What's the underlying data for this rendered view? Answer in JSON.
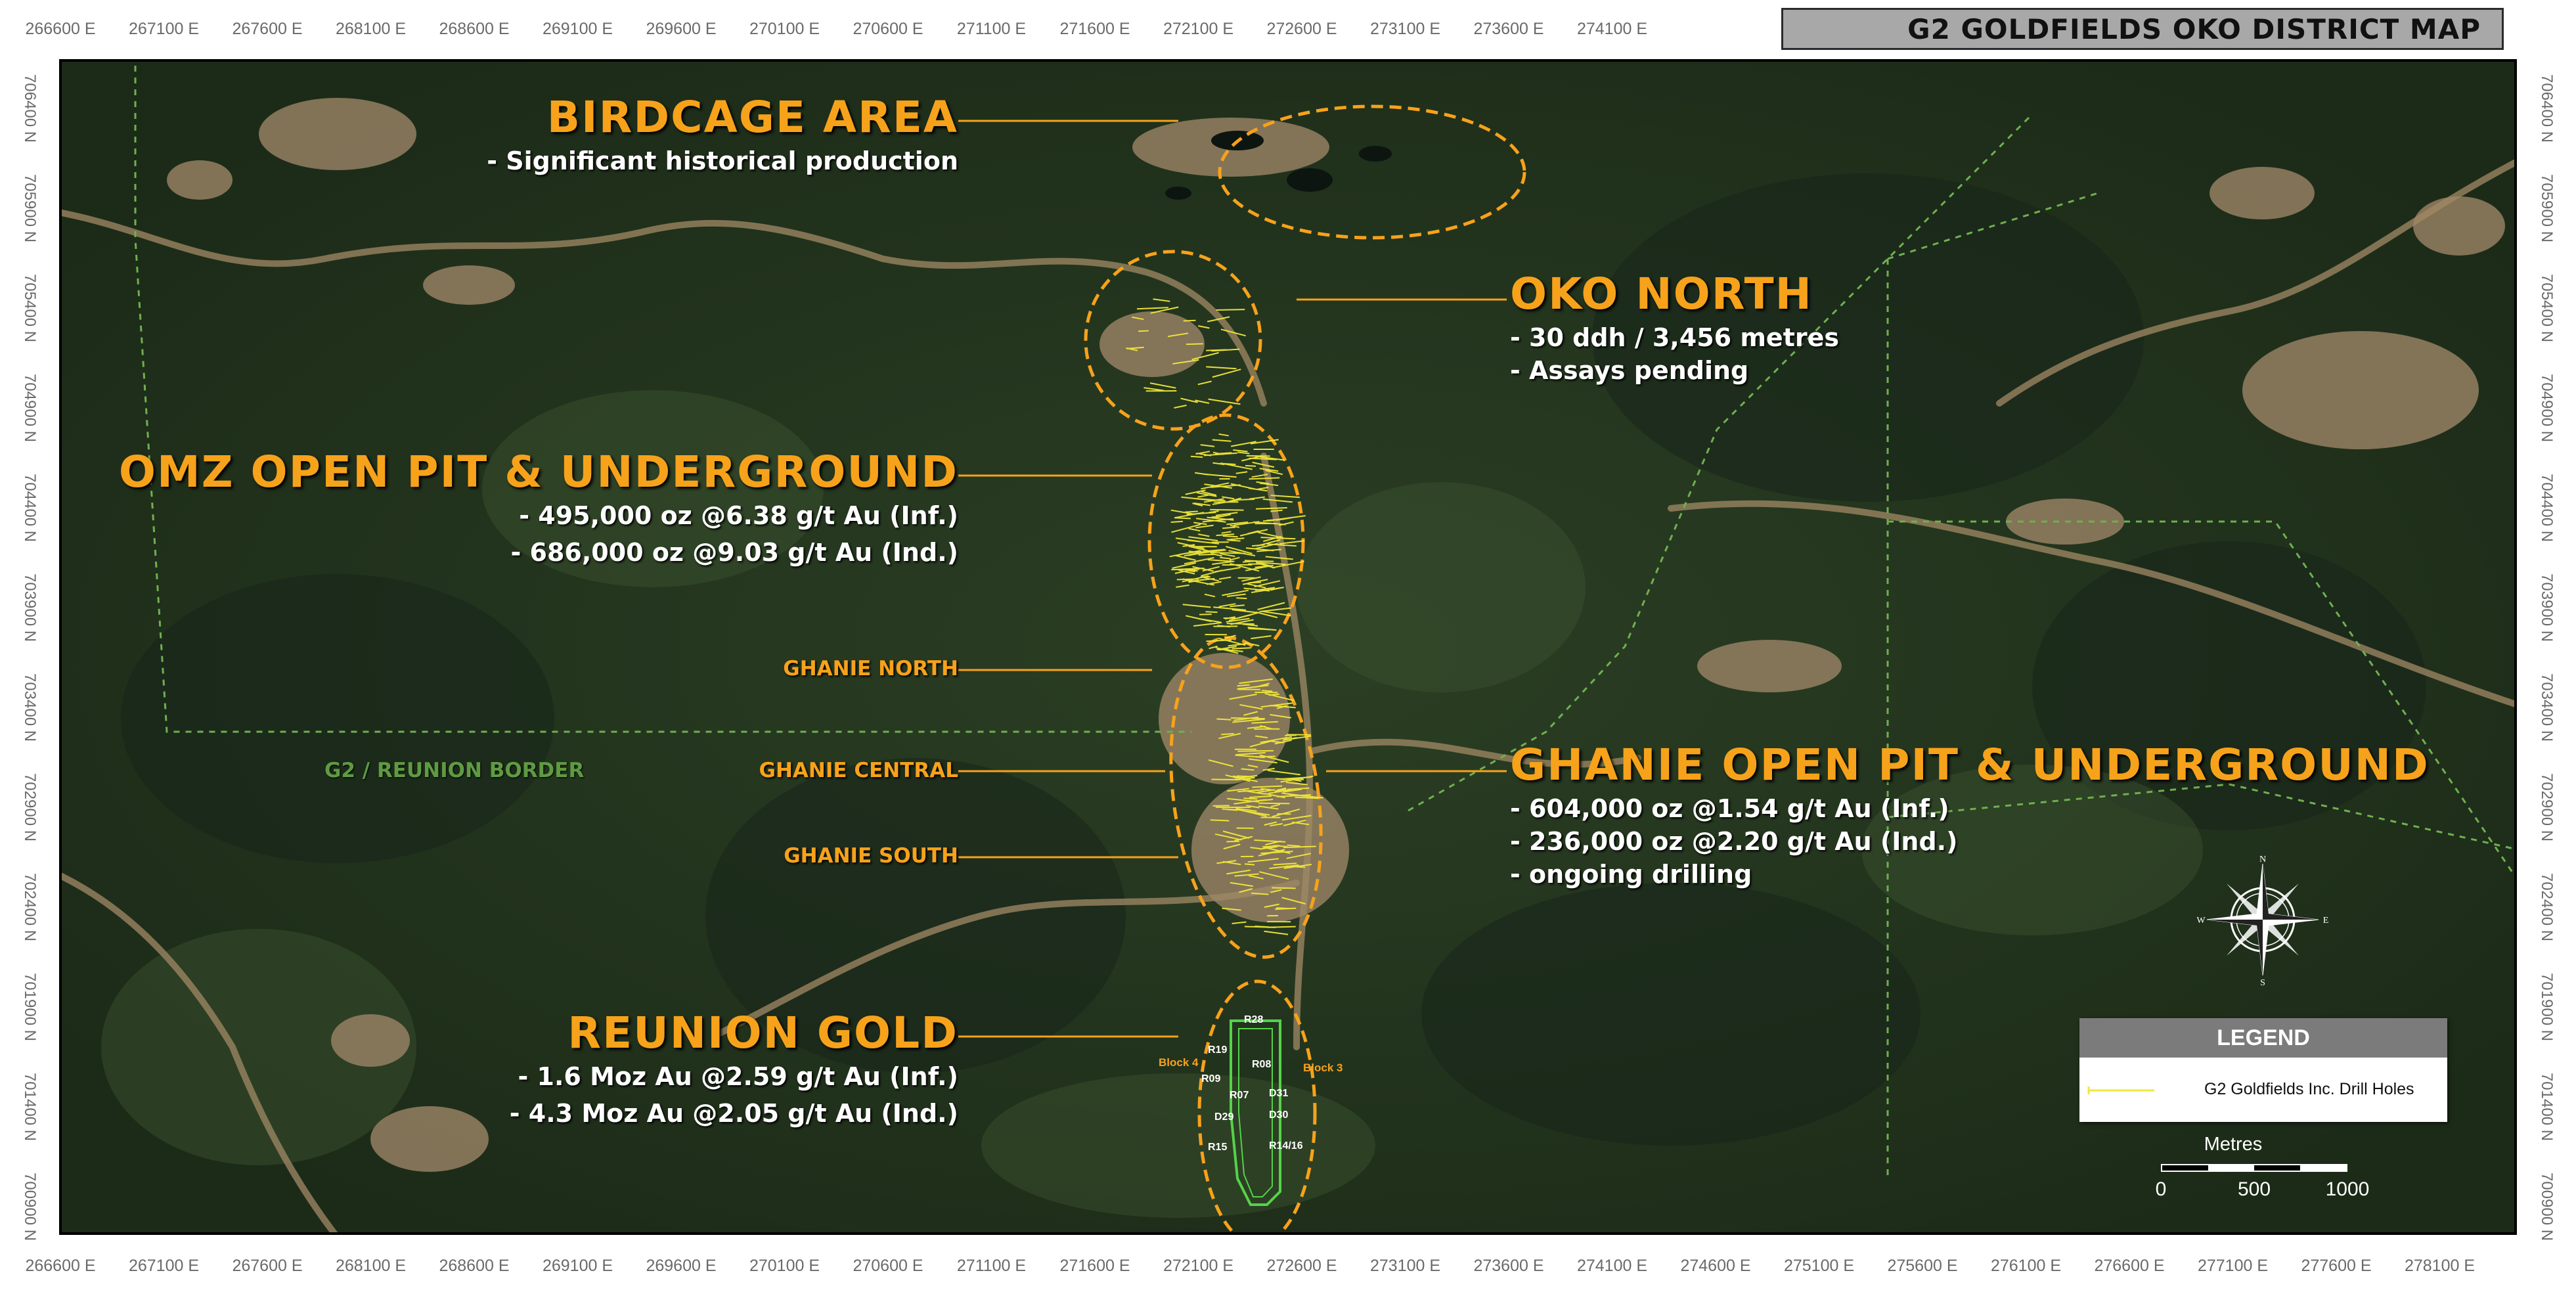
{
  "title": "G2 GOLDFIELDS OKO DISTRICT MAP",
  "easting_labels_top": [
    "266600 E",
    "267100 E",
    "267600 E",
    "268100 E",
    "268600 E",
    "269100 E",
    "269600 E",
    "270100 E",
    "270600 E",
    "271100 E",
    "271600 E",
    "272100 E",
    "272600 E",
    "273100 E",
    "273600 E",
    "274100 E"
  ],
  "easting_labels_bottom": [
    "266600 E",
    "267100 E",
    "267600 E",
    "268100 E",
    "268600 E",
    "269100 E",
    "269600 E",
    "270100 E",
    "270600 E",
    "271100 E",
    "271600 E",
    "272100 E",
    "272600 E",
    "273100 E",
    "273600 E",
    "274100 E",
    "274600 E",
    "275100 E",
    "275600 E",
    "276100 E",
    "276600 E",
    "277100 E",
    "277600 E",
    "278100 E"
  ],
  "northing_labels": [
    "706400 N",
    "705900 N",
    "705400 N",
    "704900 N",
    "704400 N",
    "703900 N",
    "703400 N",
    "702900 N",
    "702400 N",
    "701900 N",
    "701400 N",
    "700900 N"
  ],
  "areas": {
    "birdcage": {
      "title": "BIRDCAGE AREA",
      "bullets": [
        "-  Significant historical production"
      ]
    },
    "oko_north": {
      "title": "OKO NORTH",
      "bullets": [
        "-  30 ddh / 3,456 metres",
        "-  Assays pending"
      ]
    },
    "omz": {
      "title": "OMZ OPEN PIT & UNDERGROUND",
      "bullets": [
        "- 495,000 oz @6.38 g/t Au (Inf.)",
        "- 686,000 oz @9.03 g/t Au (Ind.)"
      ]
    },
    "ghanie_north": {
      "title": "GHANIE NORTH"
    },
    "ghanie_central": {
      "title": "GHANIE CENTRAL"
    },
    "ghanie_south": {
      "title": "GHANIE SOUTH"
    },
    "ghanie": {
      "title": "GHANIE OPEN PIT & UNDERGROUND",
      "bullets": [
        "- 604,000 oz @1.54 g/t Au (Inf.)",
        "- 236,000 oz @2.20 g/t Au (Ind.)",
        "- ongoing drilling"
      ]
    },
    "reunion": {
      "title": "REUNION GOLD",
      "bullets": [
        "- 1.6 Moz Au @2.59 g/t Au (Inf.)",
        "-  4.3 Moz Au @2.05 g/t Au (Ind.)"
      ]
    }
  },
  "border_label": "G2 / REUNION BORDER",
  "reunion_blocks": {
    "block4": "Block 4",
    "block3": "Block 3",
    "ids": [
      "R28",
      "R19",
      "R08",
      "R09",
      "R07",
      "D31",
      "D30",
      "D29",
      "R15",
      "R14/16"
    ]
  },
  "legend": {
    "title": "LEGEND",
    "item": "G2 Goldfields Inc. Drill Holes",
    "item_color": "#f2e83a"
  },
  "scale": {
    "title": "Metres",
    "labels": [
      "0",
      "500",
      "1000"
    ]
  },
  "compass": {
    "n": "N",
    "s": "S",
    "e": "E",
    "w": "W"
  },
  "colors": {
    "accent_orange": "#f7a21b",
    "border_green": "#6fb04f",
    "forest": "#24361f",
    "drill": "#f2e83a"
  }
}
